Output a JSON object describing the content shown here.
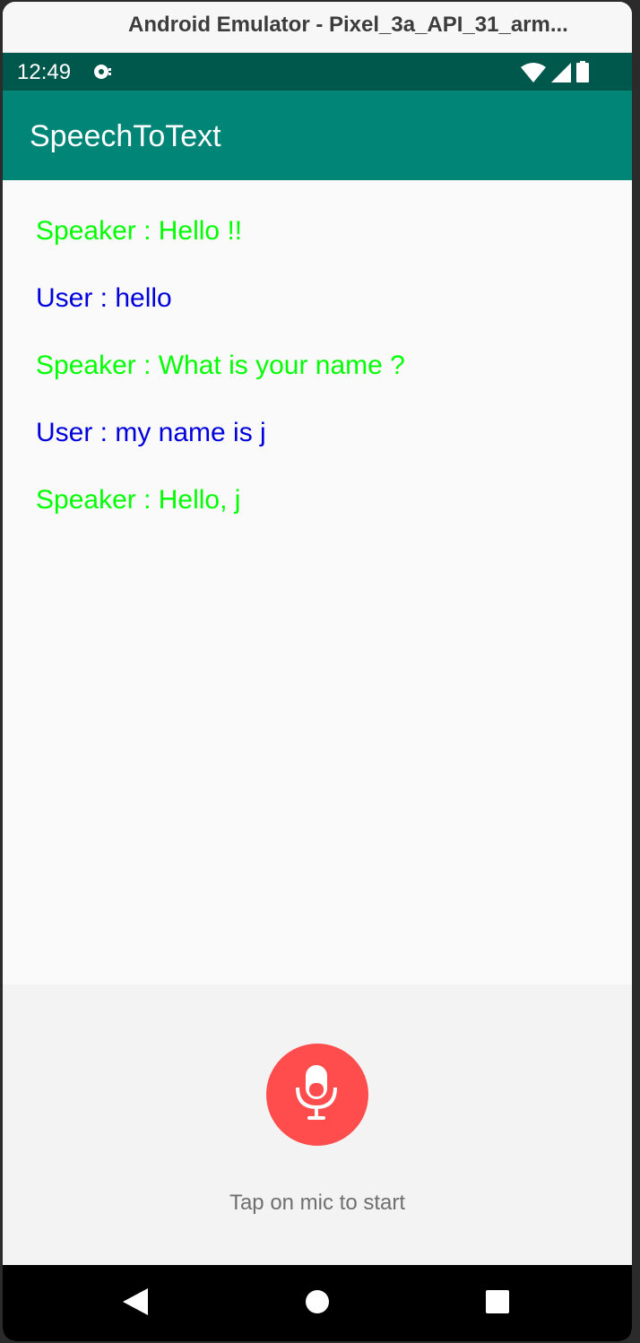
{
  "window": {
    "title": "Android Emulator - Pixel_3a_API_31_arm..."
  },
  "status_bar": {
    "time": "12:49",
    "icons": [
      "cast-icon",
      "wifi-icon",
      "cellular-signal-icon",
      "battery-icon"
    ]
  },
  "app_bar": {
    "title": "SpeechToText",
    "color": "#008577"
  },
  "conversation": {
    "messages": [
      {
        "role": "speaker",
        "text": "Speaker : Hello !!",
        "color": "#00ff00"
      },
      {
        "role": "user",
        "text": "User : hello",
        "color": "#0000dd"
      },
      {
        "role": "speaker",
        "text": "Speaker : What is your name ?",
        "color": "#00ff00"
      },
      {
        "role": "user",
        "text": "User : my name is j",
        "color": "#0000dd"
      },
      {
        "role": "speaker",
        "text": "Speaker : Hello, j",
        "color": "#00ff00"
      }
    ]
  },
  "mic": {
    "icon": "microphone-icon",
    "color": "#ff4d4d",
    "hint": "Tap on mic to start"
  },
  "nav_bar": {
    "icons": [
      "back-icon",
      "home-icon",
      "recents-icon"
    ]
  }
}
